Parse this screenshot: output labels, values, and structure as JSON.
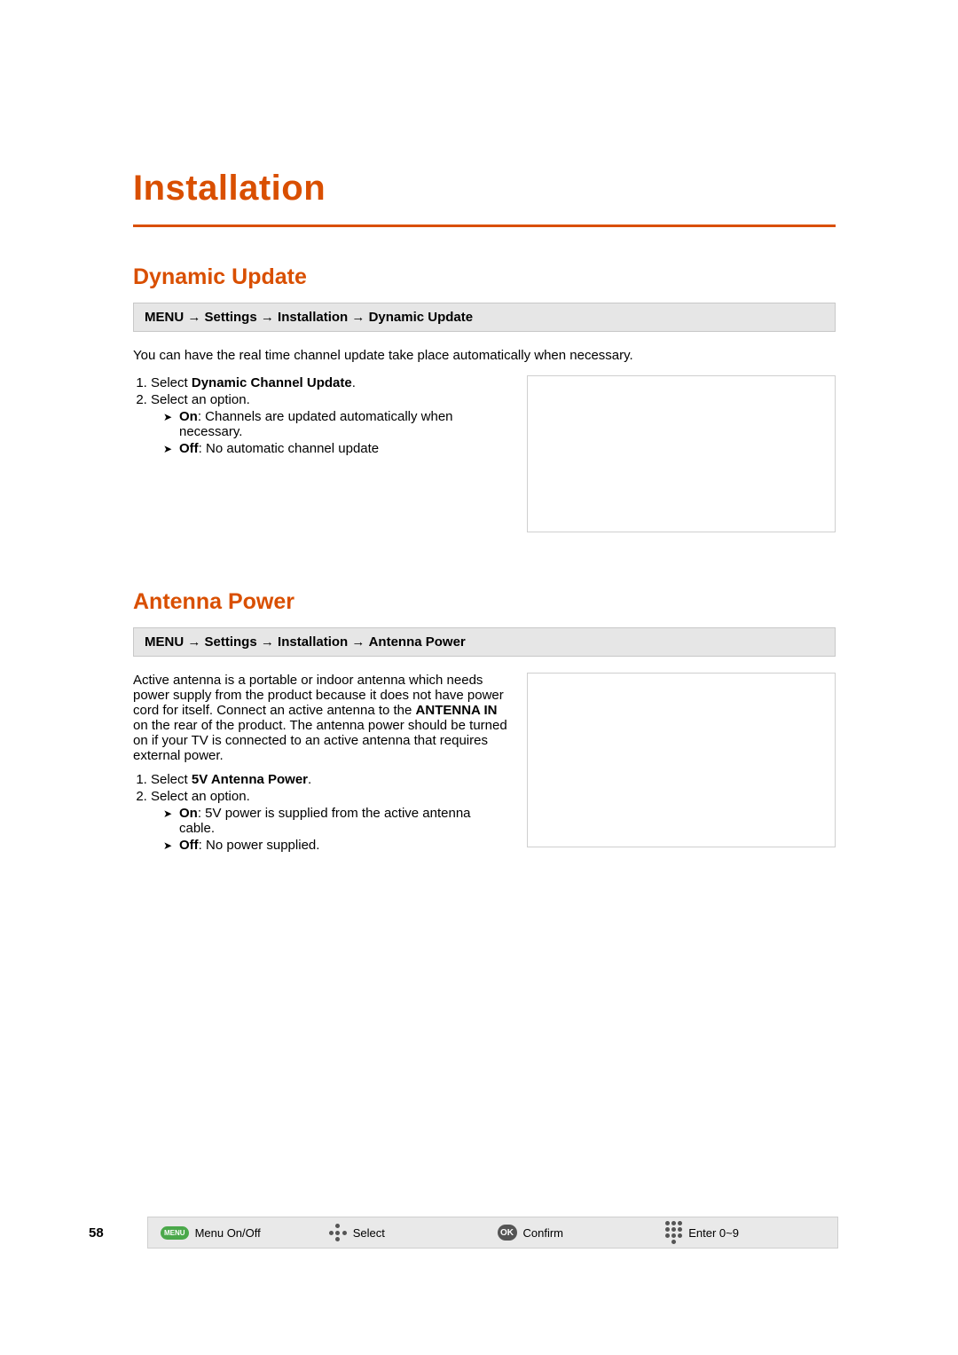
{
  "chapter": "Installation",
  "section1": {
    "title": "Dynamic Update",
    "nav": {
      "p1": "MENU",
      "p2": "Settings",
      "p3": "Installation",
      "p4": "Dynamic Update"
    },
    "lead": "You can have the real time channel update take place automatically when necessary.",
    "step1a": "Select ",
    "step1b": "Dynamic Channel Update",
    "step1c": ".",
    "step2": "Select an option.",
    "opt_on_b": "On",
    "opt_on_t": ": Channels are updated automatically when necessary.",
    "opt_off_b": "Off",
    "opt_off_t": ": No automatic channel update"
  },
  "section2": {
    "title": "Antenna Power",
    "nav": {
      "p1": "MENU",
      "p2": "Settings",
      "p3": "Installation",
      "p4": "Antenna Power"
    },
    "para_a": "Active antenna is a portable or indoor antenna which needs power supply from the product because it does not have power cord for itself. Connect an active antenna to the ",
    "para_b": "ANTENNA IN",
    "para_c": " on the rear of the product. The antenna power should be turned on if your TV is connected to an active antenna that requires external power.",
    "step1a": "Select ",
    "step1b": "5V Antenna Power",
    "step1c": ".",
    "step2": "Select an option.",
    "opt_on_b": "On",
    "opt_on_t": ": 5V power is supplied from the active antenna cable.",
    "opt_off_b": "Off",
    "opt_off_t": ": No power supplied."
  },
  "footer": {
    "page": "58",
    "menu_icon": "MENU",
    "menu": "Menu On/Off",
    "select": "Select",
    "ok_icon": "OK",
    "confirm": "Confirm",
    "enter": "Enter 0~9"
  },
  "arrow": " → "
}
